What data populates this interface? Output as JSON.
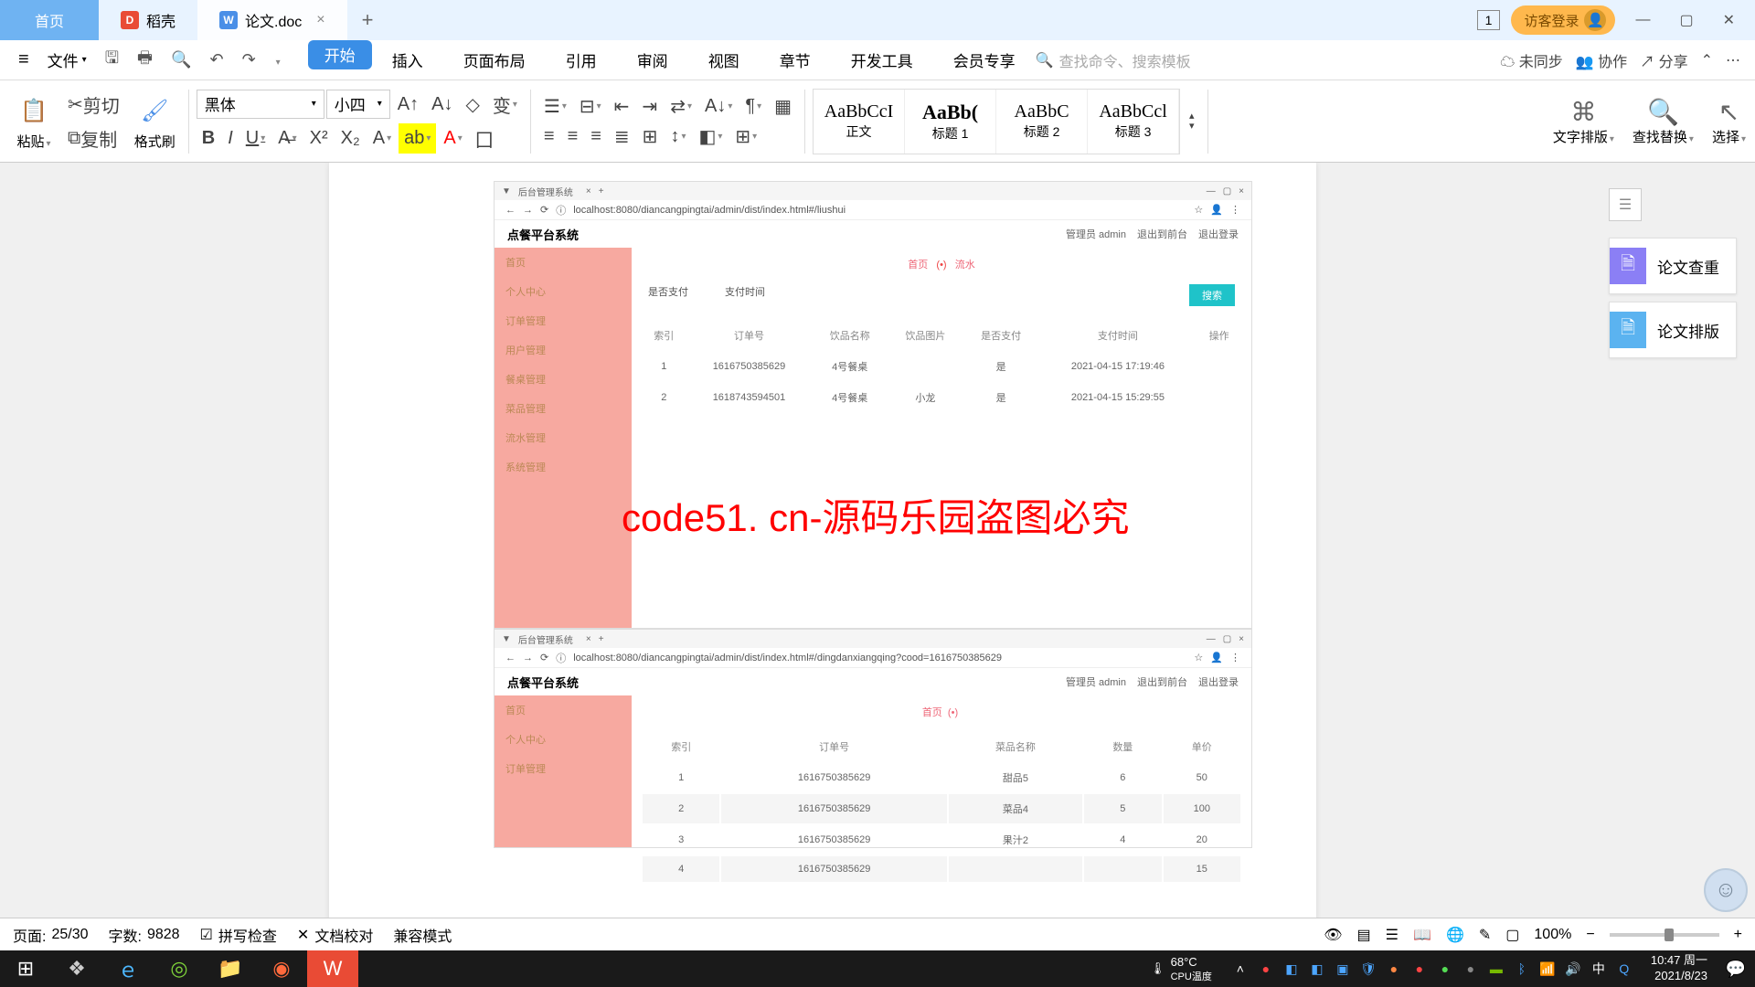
{
  "tabs": {
    "home": "首页",
    "docai": "稻壳",
    "paper": "论文.doc"
  },
  "title_right": {
    "badge": "1",
    "login": "访客登录"
  },
  "file_menu": "文件",
  "quick": {
    "cut": "剪切",
    "copy": "复制",
    "paste": "粘贴",
    "brush": "格式刷"
  },
  "menus": [
    "开始",
    "插入",
    "页面布局",
    "引用",
    "审阅",
    "视图",
    "章节",
    "开发工具",
    "会员专享"
  ],
  "search_placeholder": "查找命令、搜索模板",
  "menu_right": {
    "unsync": "未同步",
    "collab": "协作",
    "share": "分享"
  },
  "font": {
    "name": "黑体",
    "size": "小四"
  },
  "styles": [
    {
      "preview": "AaBbCcI",
      "label": "正文"
    },
    {
      "preview": "AaBb(",
      "label": "标题 1"
    },
    {
      "preview": "AaBbC",
      "label": "标题 2"
    },
    {
      "preview": "AaBbCcl",
      "label": "标题 3"
    }
  ],
  "rtools": {
    "layout": "文字排版",
    "find": "查找替换",
    "select": "选择"
  },
  "sidepanel": {
    "check": "论文查重",
    "layout": "论文排版"
  },
  "statusbar": {
    "page_label": "页面:",
    "page": "25/30",
    "words_label": "字数:",
    "words": "9828",
    "spell": "拼写检查",
    "proof": "文档校对",
    "compat": "兼容模式",
    "zoom": "100%"
  },
  "overlay": "code51. cn-源码乐园盗图必究",
  "watermark": "code51.cn",
  "screenshots": {
    "tab_title": "后台管理系统",
    "url1": "localhost:8080/diancangpingtai/admin/dist/index.html#/liushui",
    "url2": "localhost:8080/diancangpingtai/admin/dist/index.html#/dingdanxiangqing?cood=1616750385629",
    "app_title": "点餐平台系统",
    "admin": "管理员 admin",
    "back": "退出到前台",
    "logout": "退出登录",
    "crumb": "首页",
    "crumb_sub": "流水",
    "filters": {
      "f1": "是否支付",
      "f2": "支付时间",
      "btn": "搜索"
    },
    "t1_head": [
      "索引",
      "订单号",
      "饮品名称",
      "饮品图片",
      "是否支付",
      "支付时间",
      "操作"
    ],
    "t1_rows": [
      [
        "1",
        "1616750385629",
        "4号餐桌",
        "",
        "是",
        "2021-04-15 17:19:46",
        ""
      ],
      [
        "2",
        "1618743594501",
        "4号餐桌",
        "小龙",
        "是",
        "2021-04-15 15:29:55",
        ""
      ]
    ],
    "t2_head": [
      "索引",
      "订单号",
      "菜品名称",
      "数量",
      "单价"
    ],
    "t2_rows": [
      [
        "1",
        "1616750385629",
        "甜品5",
        "6",
        "50"
      ],
      [
        "2",
        "1616750385629",
        "菜品4",
        "5",
        "100"
      ],
      [
        "3",
        "1616750385629",
        "果汁2",
        "4",
        "20"
      ],
      [
        "4",
        "1616750385629",
        "",
        "",
        "15"
      ]
    ]
  },
  "taskbar": {
    "temp": "68°C",
    "temp_label": "CPU温度",
    "time": "10:47 周一",
    "date": "2021/8/23"
  }
}
